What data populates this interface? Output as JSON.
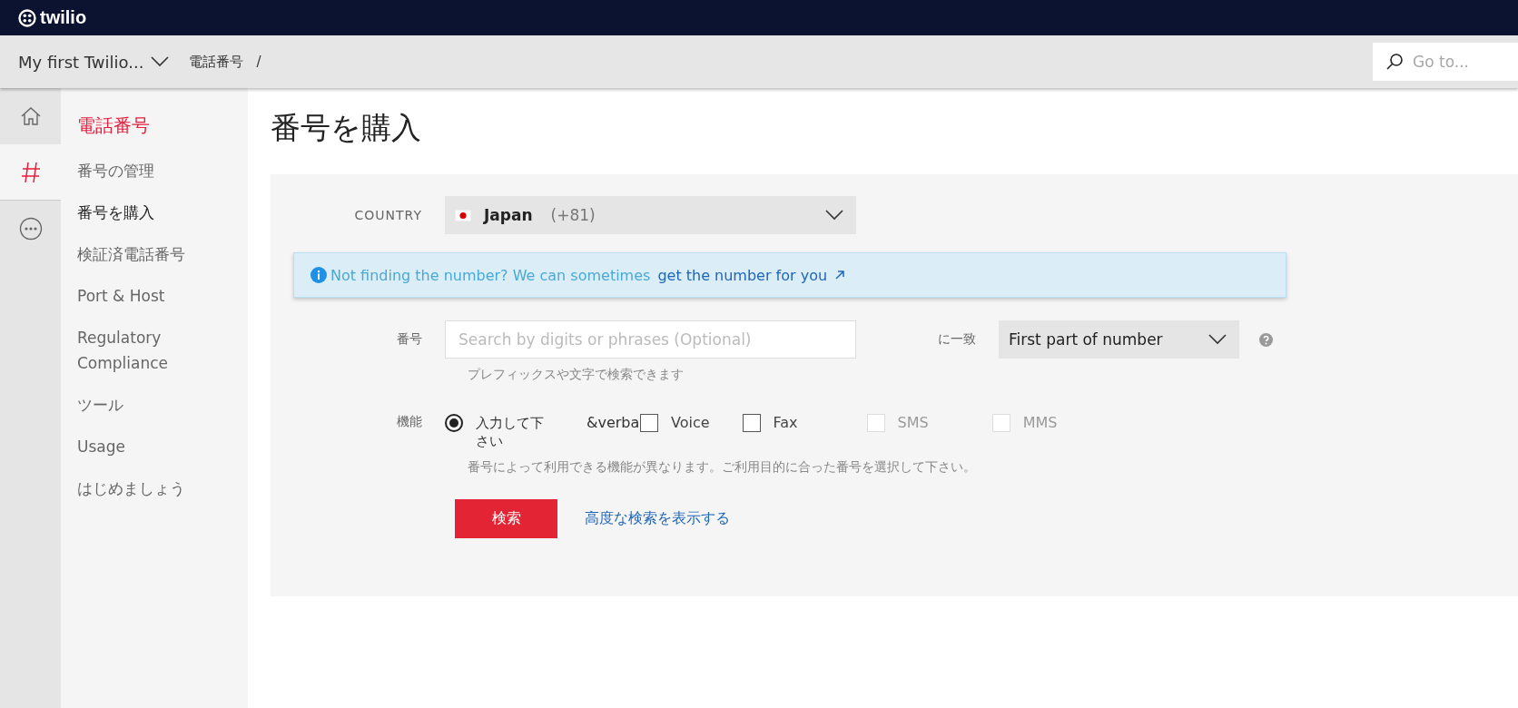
{
  "topbar": {
    "logo": "twilio"
  },
  "breadcrumb": {
    "project": "My first Twilio...",
    "items": [
      "電話番号"
    ],
    "separator": "/",
    "search": {
      "placeholder": "Go to..."
    }
  },
  "rail": [
    {
      "kind": "home",
      "selected": false
    },
    {
      "kind": "hash",
      "selected": true
    },
    {
      "kind": "more",
      "selected": false
    }
  ],
  "sidebar": {
    "title": "電話番号",
    "items": [
      {
        "label": "番号の管理",
        "selected": false
      },
      {
        "label": "番号を購入",
        "selected": true
      },
      {
        "label": "検証済電話番号",
        "selected": false
      },
      {
        "label": "Port & Host",
        "selected": false
      },
      {
        "label": "Regulatory Compliance",
        "selected": false
      },
      {
        "label": "ツール",
        "selected": false
      },
      {
        "label": "Usage",
        "selected": false
      },
      {
        "label": "はじめましょう",
        "selected": false
      }
    ]
  },
  "page": {
    "title": "番号を購入"
  },
  "form": {
    "country": {
      "label": "COUNTRY",
      "name": "Japan",
      "code": "(+81)"
    },
    "notice": {
      "text": "Not finding the number? We can sometimes",
      "link": "get the number for you"
    },
    "number": {
      "label": "番号",
      "placeholder": "Search by digits or phrases (Optional)",
      "hint": "プレフィックスや文字で検索できます"
    },
    "match": {
      "label": "に一致",
      "value": "First part of number"
    },
    "capabilities": {
      "label": "機能",
      "options": [
        {
          "kind": "radio",
          "label": "入力して下さい",
          "checked": true,
          "disabled": false
        },
        {
          "kind": "text",
          "label": "&verba"
        },
        {
          "kind": "checkbox",
          "label": "Voice",
          "checked": false,
          "disabled": false
        },
        {
          "kind": "checkbox",
          "label": "Fax",
          "checked": false,
          "disabled": false
        },
        {
          "kind": "checkbox",
          "label": "SMS",
          "checked": false,
          "disabled": true
        },
        {
          "kind": "checkbox",
          "label": "MMS",
          "checked": false,
          "disabled": true
        }
      ],
      "note": "番号によって利用できる機能が異なります。ご利用目的に合った番号を選択して下さい。"
    },
    "search_button": "検索",
    "advanced_link": "高度な検索を表示する"
  }
}
